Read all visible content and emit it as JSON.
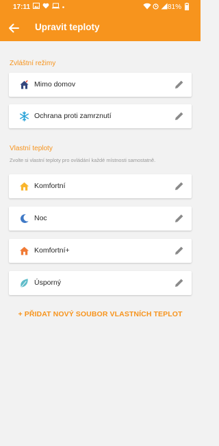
{
  "status": {
    "time": "17:11",
    "battery": "81%"
  },
  "header": {
    "title": "Upravit teploty"
  },
  "special": {
    "heading": "Zvláštní režimy",
    "items": [
      {
        "label": "Mimo domov",
        "icon": "away-house-icon"
      },
      {
        "label": "Ochrana proti zamrznutí",
        "icon": "snowflake-icon"
      }
    ]
  },
  "custom": {
    "heading": "Vlastní teploty",
    "hint": "Zvolte si vlastní teploty pro ovládání každé místnosti samostatně.",
    "items": [
      {
        "label": "Komfortní",
        "icon": "house-icon"
      },
      {
        "label": "Noc",
        "icon": "moon-icon"
      },
      {
        "label": "Komfortní+",
        "icon": "house-plus-icon"
      },
      {
        "label": "Úsporný",
        "icon": "leaf-icon"
      }
    ]
  },
  "add_button": "+ PŘIDAT NOVÝ SOUBOR VLASTNÍCH TEPLOT",
  "colors": {
    "accent": "#f7941d",
    "background": "#f2f2f2"
  }
}
